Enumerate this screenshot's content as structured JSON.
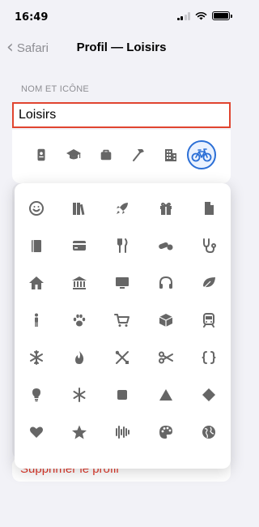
{
  "status_bar": {
    "time": "16:49"
  },
  "nav": {
    "back_label": "Safari",
    "title": "Profil — Loisirs"
  },
  "section": {
    "header": "NOM ET ICÔNE"
  },
  "name_field": {
    "value": "Loisirs"
  },
  "icon_row": [
    "id-card-icon",
    "graduation-cap-icon",
    "briefcase-icon",
    "hammer-icon",
    "building-icon",
    "bicycle-icon"
  ],
  "icon_row_selected": "bicycle-icon",
  "icon_grid": [
    "smiley-icon",
    "books-icon",
    "rocket-icon",
    "gift-icon",
    "document-icon",
    "book-icon",
    "credit-card-icon",
    "fork-knife-icon",
    "pills-icon",
    "stethoscope-icon",
    "house-icon",
    "bank-icon",
    "display-icon",
    "headphones-icon",
    "leaf-icon",
    "person-icon",
    "pawprint-icon",
    "cart-icon",
    "box-icon",
    "train-icon",
    "snowflake-icon",
    "flame-icon",
    "tools-icon",
    "scissors-icon",
    "braces-icon",
    "lightbulb-icon",
    "asterisk-icon",
    "square-icon",
    "triangle-icon",
    "diamond-icon",
    "heart-icon",
    "star-icon",
    "music-wave-icon",
    "palette-icon",
    "globe-icon"
  ],
  "delete_profile": {
    "label": "Supprimer le profil"
  },
  "colors": {
    "accent": "#2b6fd6",
    "highlight_border": "#e04530",
    "destructive": "#e0392b",
    "icon_grey": "#666666"
  }
}
